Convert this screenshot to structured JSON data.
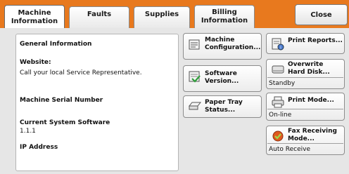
{
  "tabs": [
    {
      "label": "Machine\nInformation",
      "active": true
    },
    {
      "label": "Faults"
    },
    {
      "label": "Supplies"
    },
    {
      "label": "Billing\nInformation"
    }
  ],
  "close_label": "Close",
  "info": {
    "general_information": "General Information",
    "website_label": "Website:",
    "website_value": "Call your local Service Representative.",
    "serial_label": "Machine Serial Number",
    "software_label": "Current System Software",
    "software_value": "1.1.1",
    "ip_label": "IP Address"
  },
  "buttons": {
    "machine_configuration": "Machine\nConfiguration...",
    "software_version": "Software\nVersion...",
    "paper_tray_status": "Paper Tray\nStatus...",
    "print_reports": "Print Reports...",
    "overwrite_hard_disk": "Overwrite\nHard Disk...",
    "overwrite_status": "Standby",
    "print_mode": "Print Mode...",
    "print_mode_status": "On-line",
    "fax_receiving_mode": "Fax Receiving\nMode...",
    "fax_status": "Auto Receive"
  },
  "colors": {
    "tab_bar": "#e8791e",
    "background": "#e6e6e6"
  }
}
